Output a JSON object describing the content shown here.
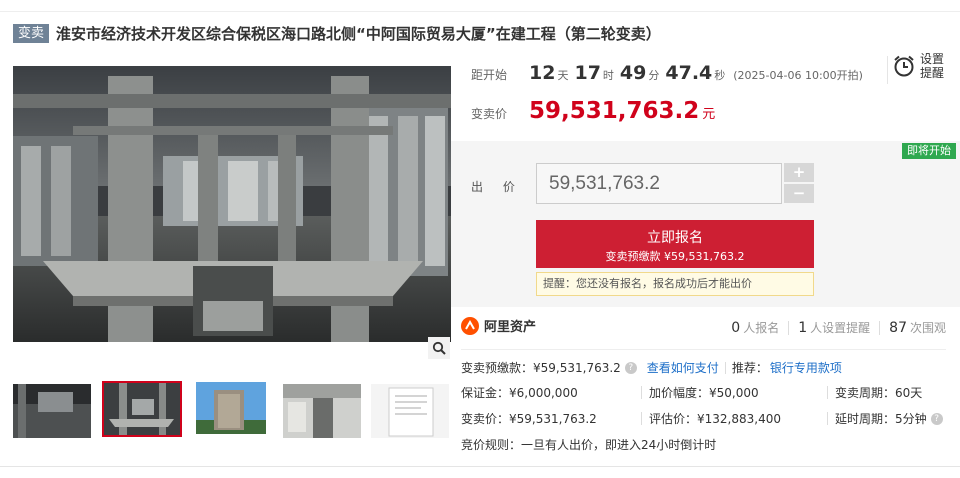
{
  "header": {
    "tag": "变卖",
    "title": "淮安市经济技术开发区综合保税区海口路北侧“中阿国际贸易大厦”在建工程（第二轮变卖）"
  },
  "countdown": {
    "label": "距开始",
    "days": "12",
    "days_unit": "天",
    "hours": "17",
    "hours_unit": "时",
    "minutes": "49",
    "minutes_unit": "分",
    "seconds": "47.4",
    "seconds_unit": "秒",
    "start": "(2025-04-06 10:00开拍)"
  },
  "reminder": {
    "line1": "设置",
    "line2": "提醒",
    "icon": "alarm-clock-icon"
  },
  "price": {
    "label": "变卖价",
    "value": "59,531,763.2",
    "unit": "元",
    "color": "#d0021b"
  },
  "bid": {
    "status_badge": "即将开始",
    "label": "出 价",
    "input_value": "59,531,763.2",
    "plus": "+",
    "minus": "−",
    "signup_main": "立即报名",
    "signup_sub": "变卖预缴款 ¥59,531,763.2",
    "hint": "提醒：您还没有报名，报名成功后才能出价"
  },
  "brand": {
    "name": "阿里资产"
  },
  "stats": [
    {
      "n": "0",
      "t": "人报名"
    },
    {
      "n": "1",
      "t": "人设置提醒"
    },
    {
      "n": "87",
      "t": "次围观"
    }
  ],
  "details": {
    "deposit_label": "变卖预缴款：¥59,531,763.2",
    "how_to_pay": "查看如何支付",
    "recommend": "推荐：",
    "bank_link": "银行专用款项",
    "margin": "保证金：¥6,000,000",
    "increment": "加价幅度：¥50,000",
    "period": "变卖周期：60天",
    "sale_price": "变卖价：¥59,531,763.2",
    "appraisal": "评估价：¥132,883,400",
    "delay": "延时周期：5分钟",
    "rule": "竞价规则：一旦有人出价，即进入24小时倒计时"
  }
}
